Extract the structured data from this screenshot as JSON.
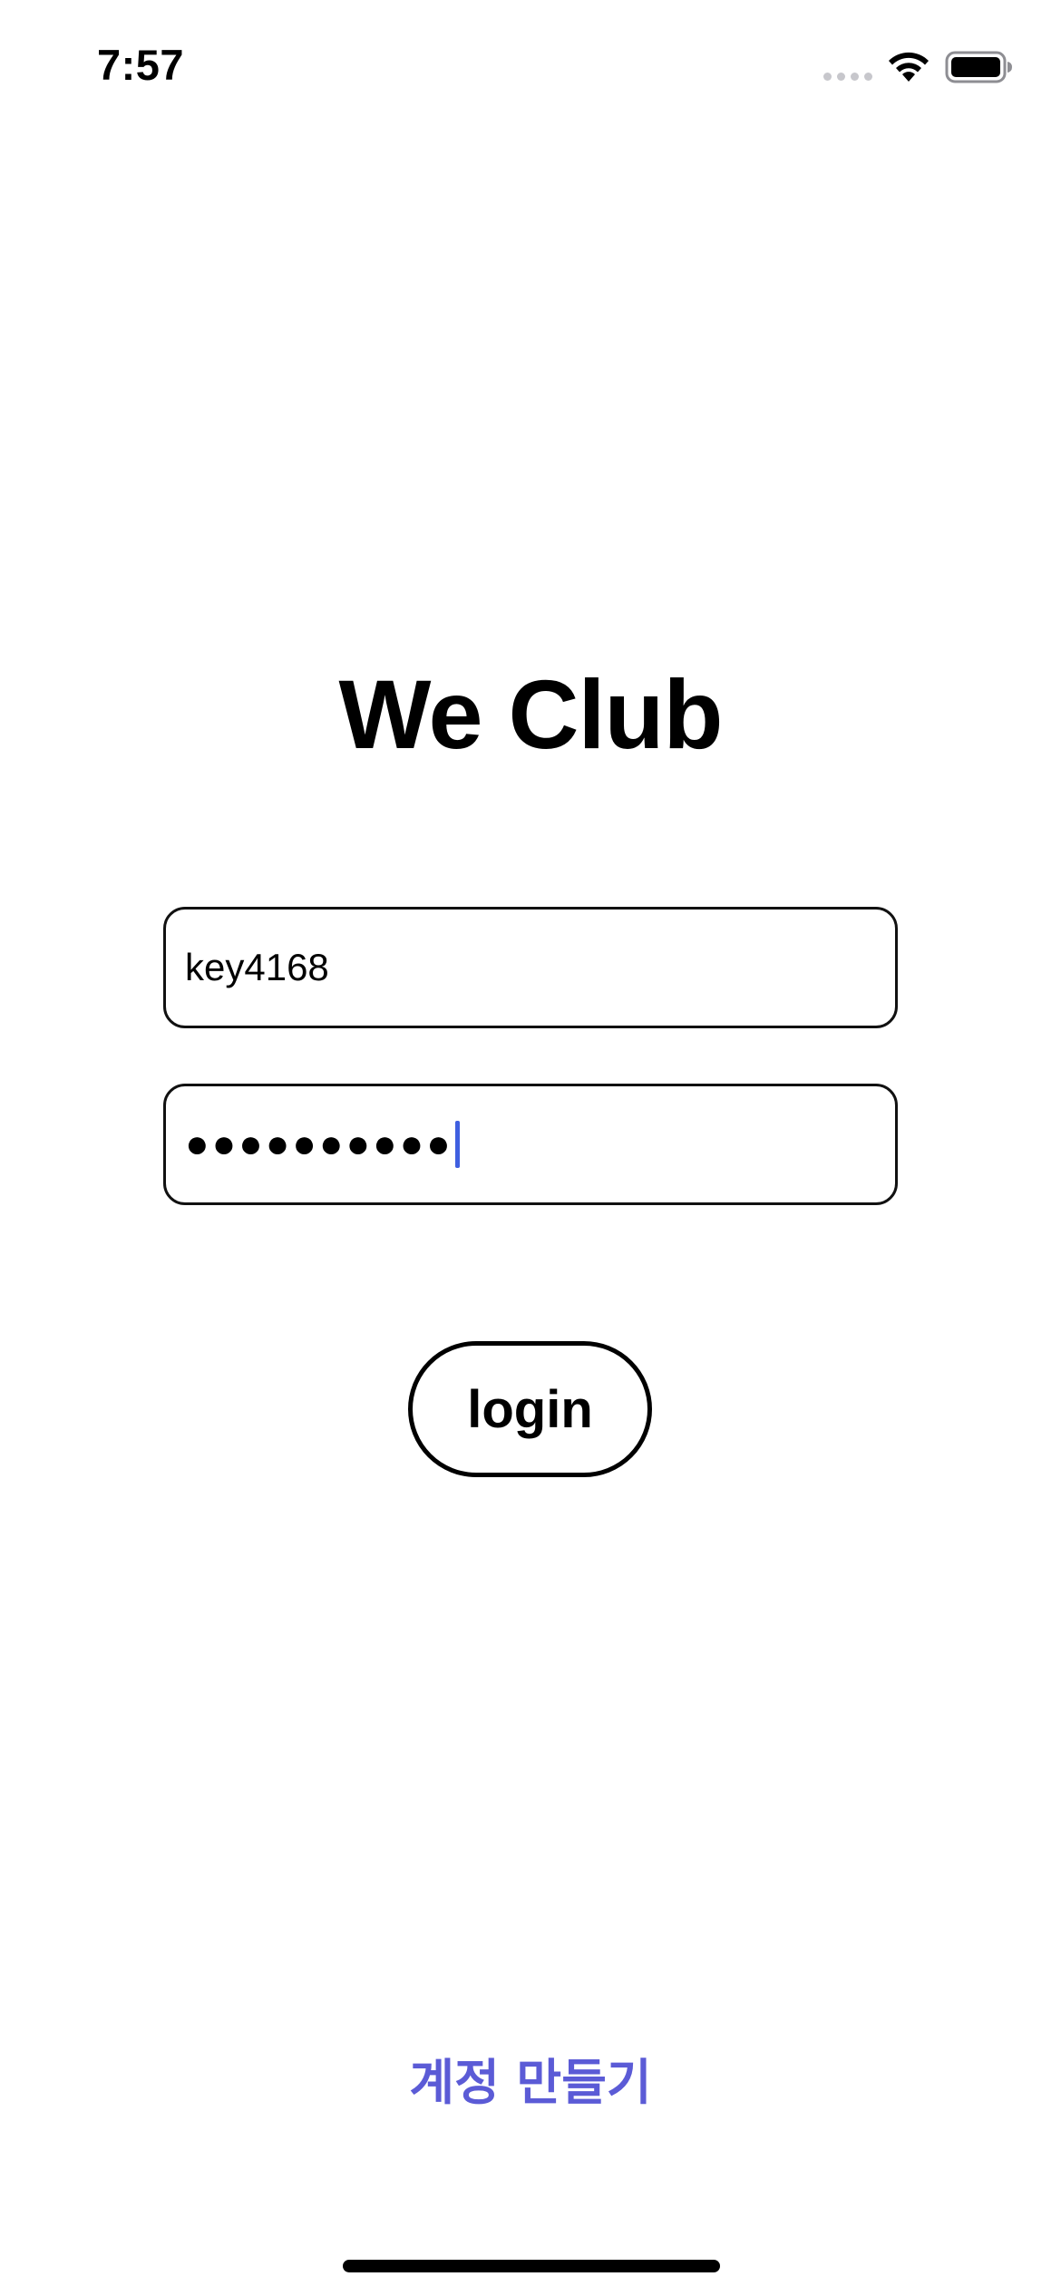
{
  "status_bar": {
    "time": "7:57",
    "wifi_icon": "wifi-icon",
    "battery_icon": "battery-icon",
    "signal_icon": "cellular-signal-dots-icon"
  },
  "title": "We Club",
  "username_field": {
    "value": "key4168"
  },
  "password_field": {
    "masked_value": "●●●●●●●●●●",
    "focused": true
  },
  "login_button": {
    "label": "login"
  },
  "create_account_link": {
    "label": "계정 만들기"
  },
  "colors": {
    "accent_link": "#5b5bd6",
    "cursor": "#3f5fe0",
    "border": "#111111",
    "background": "#ffffff"
  }
}
